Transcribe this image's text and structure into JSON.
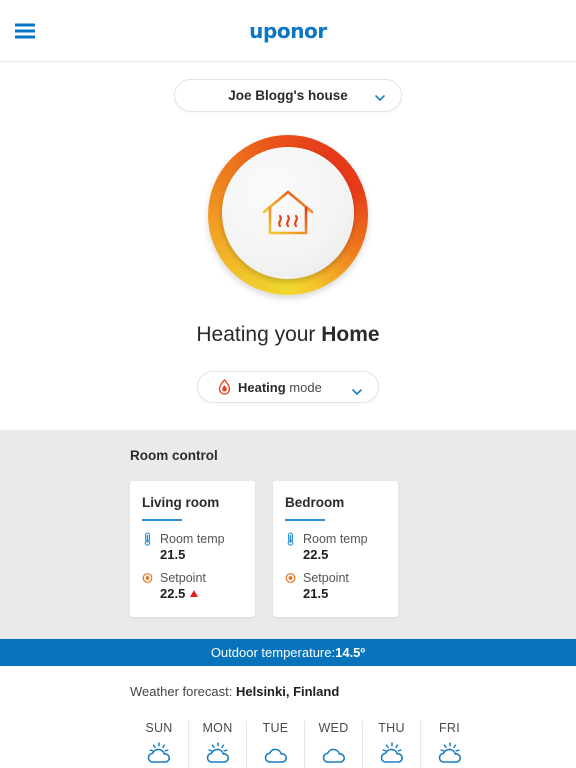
{
  "header": {
    "menu_icon": "hamburger-menu-icon",
    "brand": "uponor"
  },
  "house_selector": {
    "value": "Joe Blogg's house",
    "chevron_icon": "chevron-down-icon"
  },
  "dial": {
    "icon": "house-heating-icon",
    "gradient_start": "#f0d82e",
    "gradient_end": "#e5391a"
  },
  "headline": {
    "prefix": "Heating your ",
    "emphasis": "Home"
  },
  "mode_selector": {
    "icon": "flame-icon",
    "emphasis": "Heating",
    "suffix": " mode",
    "chevron_icon": "chevron-down-icon"
  },
  "room_control": {
    "title": "Room control",
    "accent_color": "#2a8fd4",
    "cards": [
      {
        "name": "Living room",
        "metrics": [
          {
            "icon": "thermometer-icon",
            "label": "Room temp",
            "value": "21.5",
            "trend": ""
          },
          {
            "icon": "setpoint-target-icon",
            "label": "Setpoint",
            "value": "22.5",
            "trend": "up"
          }
        ]
      },
      {
        "name": "Bedroom",
        "metrics": [
          {
            "icon": "thermometer-icon",
            "label": "Room temp",
            "value": "22.5",
            "trend": ""
          },
          {
            "icon": "setpoint-target-icon",
            "label": "Setpoint",
            "value": "21.5",
            "trend": ""
          }
        ]
      }
    ]
  },
  "outdoor": {
    "label": "Outdoor temperature: ",
    "value": "14.5º",
    "background_color": "#0673ba"
  },
  "weather": {
    "label": "Weather forecast: ",
    "location": "Helsinki, Finland",
    "icon_color": "#1a7ec4",
    "days": [
      {
        "name": "SUN",
        "icon": "sun-behind-cloud-icon"
      },
      {
        "name": "MON",
        "icon": "sun-behind-cloud-icon"
      },
      {
        "name": "TUE",
        "icon": "cloud-icon"
      },
      {
        "name": "WED",
        "icon": "cloud-icon"
      },
      {
        "name": "THU",
        "icon": "sun-behind-cloud-icon"
      },
      {
        "name": "FRI",
        "icon": "sun-behind-cloud-icon"
      }
    ]
  }
}
